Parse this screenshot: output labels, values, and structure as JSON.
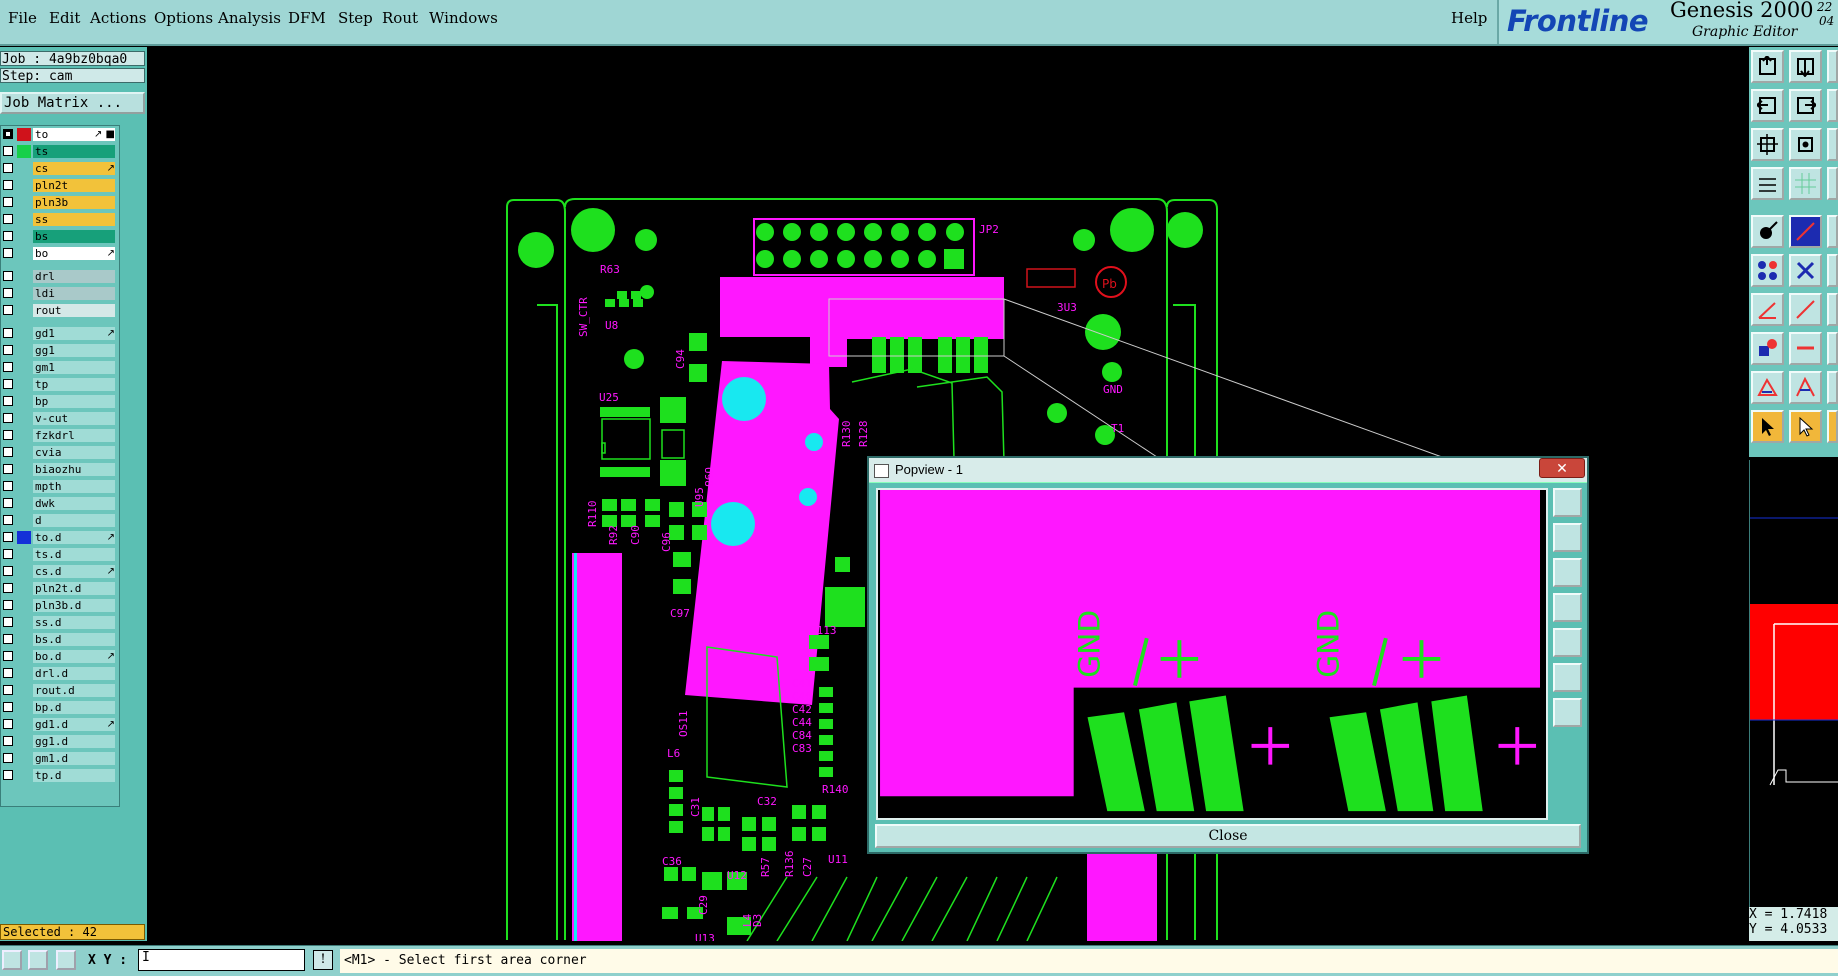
{
  "menubar": {
    "items": [
      "File",
      "Edit",
      "Actions",
      "Options",
      "Analysis",
      "DFM",
      "Step",
      "Rout",
      "Windows"
    ],
    "help": "Help"
  },
  "brand": {
    "logo": "Frontline",
    "title": "Genesis 2000",
    "subtitle": "Graphic Editor",
    "num1": "22",
    "num2": "04"
  },
  "leftpanel": {
    "job": "Job : 4a9bz0bqa0",
    "step": "Step: cam",
    "job_matrix": "Job Matrix ...",
    "selected": "Selected : 42",
    "layers": [
      {
        "name": "to",
        "color": "#ffffff",
        "swatch": "#d0121b",
        "checked": true,
        "mark": "↗ ■"
      },
      {
        "name": "ts",
        "color": "#17a07a",
        "swatch": "#17d04a",
        "checked": false,
        "mark": ""
      },
      {
        "name": "cs",
        "color": "#f2c23a",
        "swatch": "",
        "checked": false,
        "mark": "↗"
      },
      {
        "name": "pln2t",
        "color": "#f2c23a",
        "swatch": "",
        "checked": false,
        "mark": ""
      },
      {
        "name": "pln3b",
        "color": "#f2c23a",
        "swatch": "",
        "checked": false,
        "mark": ""
      },
      {
        "name": "ss",
        "color": "#f2c23a",
        "swatch": "",
        "checked": false,
        "mark": ""
      },
      {
        "name": "bs",
        "color": "#17a07a",
        "swatch": "",
        "checked": false,
        "mark": ""
      },
      {
        "name": "bo",
        "color": "#ffffff",
        "swatch": "",
        "checked": false,
        "mark": "↗"
      },
      {
        "name": "drl",
        "color": "#a9c9c9",
        "swatch": "",
        "checked": false,
        "mark": "",
        "gap": true
      },
      {
        "name": "ldi",
        "color": "#a9c9c9",
        "swatch": "",
        "checked": false,
        "mark": ""
      },
      {
        "name": "rout",
        "color": "#d5e8e7",
        "swatch": "",
        "checked": false,
        "mark": ""
      },
      {
        "name": "gd1",
        "color": "#a0dcd6",
        "swatch": "",
        "checked": false,
        "mark": "↗",
        "gap": true
      },
      {
        "name": "gg1",
        "color": "#a0dcd6",
        "swatch": "",
        "checked": false,
        "mark": ""
      },
      {
        "name": "gm1",
        "color": "#a0dcd6",
        "swatch": "",
        "checked": false,
        "mark": ""
      },
      {
        "name": "tp",
        "color": "#a0dcd6",
        "swatch": "",
        "checked": false,
        "mark": ""
      },
      {
        "name": "bp",
        "color": "#a0dcd6",
        "swatch": "",
        "checked": false,
        "mark": ""
      },
      {
        "name": "v-cut",
        "color": "#a0dcd6",
        "swatch": "",
        "checked": false,
        "mark": ""
      },
      {
        "name": "fzkdrl",
        "color": "#a0dcd6",
        "swatch": "",
        "checked": false,
        "mark": ""
      },
      {
        "name": "cvia",
        "color": "#a0dcd6",
        "swatch": "",
        "checked": false,
        "mark": ""
      },
      {
        "name": "biaozhu",
        "color": "#a0dcd6",
        "swatch": "",
        "checked": false,
        "mark": ""
      },
      {
        "name": "mpth",
        "color": "#a0dcd6",
        "swatch": "",
        "checked": false,
        "mark": ""
      },
      {
        "name": "dwk",
        "color": "#a0dcd6",
        "swatch": "",
        "checked": false,
        "mark": ""
      },
      {
        "name": "d",
        "color": "#a0dcd6",
        "swatch": "",
        "checked": false,
        "mark": ""
      },
      {
        "name": "to.d",
        "color": "#a0dcd6",
        "swatch": "#1430d8",
        "checked": false,
        "mark": "↗"
      },
      {
        "name": "ts.d",
        "color": "#a0dcd6",
        "swatch": "",
        "checked": false,
        "mark": ""
      },
      {
        "name": "cs.d",
        "color": "#a0dcd6",
        "swatch": "",
        "checked": false,
        "mark": "↗"
      },
      {
        "name": "pln2t.d",
        "color": "#a0dcd6",
        "swatch": "",
        "checked": false,
        "mark": ""
      },
      {
        "name": "pln3b.d",
        "color": "#a0dcd6",
        "swatch": "",
        "checked": false,
        "mark": ""
      },
      {
        "name": "ss.d",
        "color": "#a0dcd6",
        "swatch": "",
        "checked": false,
        "mark": ""
      },
      {
        "name": "bs.d",
        "color": "#a0dcd6",
        "swatch": "",
        "checked": false,
        "mark": ""
      },
      {
        "name": "bo.d",
        "color": "#a0dcd6",
        "swatch": "",
        "checked": false,
        "mark": "↗"
      },
      {
        "name": "drl.d",
        "color": "#a0dcd6",
        "swatch": "",
        "checked": false,
        "mark": ""
      },
      {
        "name": "rout.d",
        "color": "#a0dcd6",
        "swatch": "",
        "checked": false,
        "mark": ""
      },
      {
        "name": "bp.d",
        "color": "#a0dcd6",
        "swatch": "",
        "checked": false,
        "mark": ""
      },
      {
        "name": "gd1.d",
        "color": "#a0dcd6",
        "swatch": "",
        "checked": false,
        "mark": "↗"
      },
      {
        "name": "gg1.d",
        "color": "#a0dcd6",
        "swatch": "",
        "checked": false,
        "mark": ""
      },
      {
        "name": "gm1.d",
        "color": "#a0dcd6",
        "swatch": "",
        "checked": false,
        "mark": ""
      },
      {
        "name": "tp.d",
        "color": "#a0dcd6",
        "swatch": "",
        "checked": false,
        "mark": ""
      }
    ]
  },
  "canvas": {
    "labels": [
      "JP2",
      "R63",
      "SW_CTR",
      "U8",
      "C94",
      "U25",
      "3U3",
      "GND",
      "T1",
      "C96",
      "C97",
      "U98",
      "U95",
      "R110",
      "R92",
      "C90",
      "R113",
      "C41",
      "C46",
      "C42",
      "C44",
      "C84",
      "C83",
      "R140",
      "L6",
      "C31",
      "C32",
      "C36",
      "R57",
      "R136",
      "C27",
      "U11",
      "U12",
      "R130",
      "R128",
      "OS11",
      "D3",
      "L4",
      "U13",
      "C29"
    ],
    "colors": {
      "copper": "#1ee01e",
      "mask": "#ff17ff",
      "drill": "#18e8f0",
      "outline": "#1ee01e"
    }
  },
  "popup": {
    "title": "Popview - 1",
    "close_x": "✕",
    "close_button": "Close",
    "labels": [
      "GND",
      "GND"
    ]
  },
  "coords": {
    "x": "X = 1.7418",
    "y": "Y = 4.0533"
  },
  "bottombar": {
    "xy_label": "X Y :",
    "xy_value": "I",
    "excl": "!",
    "status": "<M1> - Select first area corner"
  }
}
